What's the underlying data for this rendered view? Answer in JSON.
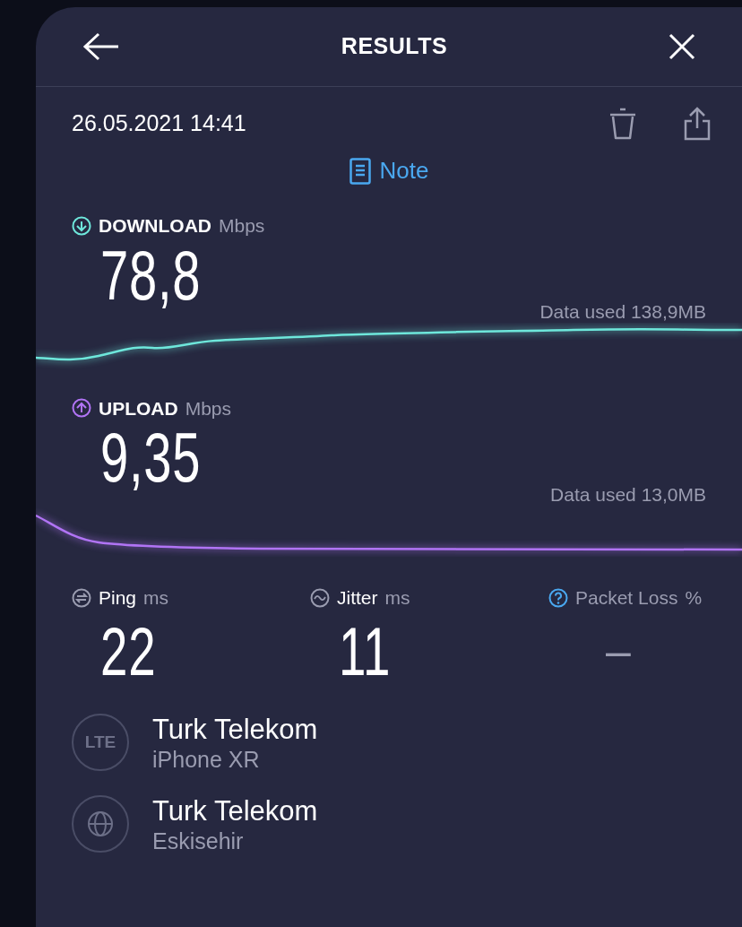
{
  "header": {
    "title": "RESULTS"
  },
  "timestamp": "26.05.2021 14:41",
  "note": {
    "label": "Note"
  },
  "speeds": [
    {
      "kind": "download",
      "label": "DOWNLOAD",
      "unit": "Mbps",
      "value": "78,8",
      "data_used": "Data used 138,9MB",
      "color": "#6ee7db"
    },
    {
      "kind": "upload",
      "label": "UPLOAD",
      "unit": "Mbps",
      "value": "9,35",
      "data_used": "Data used 13,0MB",
      "color": "#b174f5"
    }
  ],
  "metrics": [
    {
      "kind": "ping",
      "label": "Ping",
      "unit": "ms",
      "value": "22",
      "available": true
    },
    {
      "kind": "jitter",
      "label": "Jitter",
      "unit": "ms",
      "value": "11",
      "available": true
    },
    {
      "kind": "packet_loss",
      "label": "Packet Loss",
      "unit": "%",
      "value": "–",
      "available": false
    }
  ],
  "connections": [
    {
      "kind": "lte",
      "icon_text": "LTE",
      "name": "Turk Telekom",
      "detail": "iPhone XR"
    },
    {
      "kind": "globe",
      "name": "Turk Telekom",
      "detail": "Eskisehir"
    }
  ]
}
